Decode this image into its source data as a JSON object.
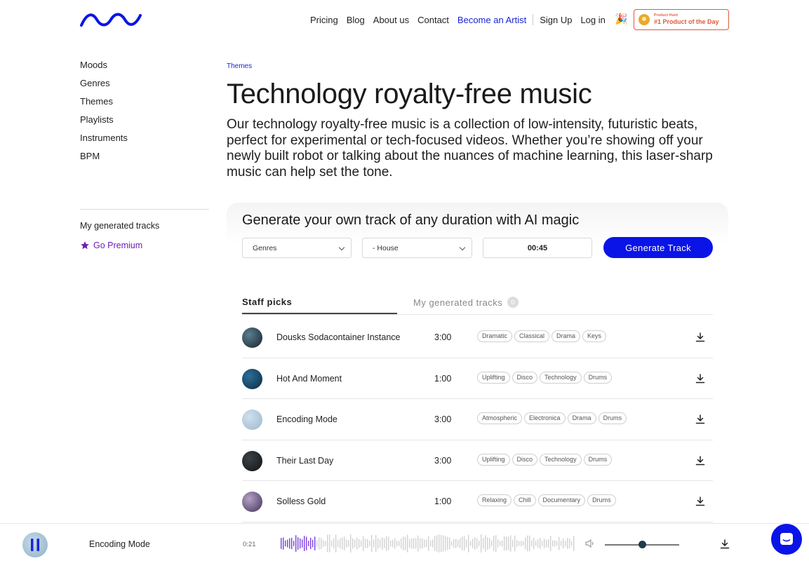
{
  "header": {
    "nav": [
      {
        "label": "Pricing"
      },
      {
        "label": "Blog"
      },
      {
        "label": "About us"
      },
      {
        "label": "Contact"
      },
      {
        "label": "Become an Artist"
      }
    ],
    "signup": "Sign Up",
    "login": "Log in",
    "badge_small": "Product Hunt",
    "badge_big": "#1 Product of the Day",
    "party_icon": "party-popper-icon"
  },
  "sidebar": {
    "items": [
      {
        "label": "Moods"
      },
      {
        "label": "Genres"
      },
      {
        "label": "Themes"
      },
      {
        "label": "Playlists"
      },
      {
        "label": "Instruments"
      },
      {
        "label": "BPM"
      }
    ],
    "generated": "My generated tracks",
    "premium": "Go Premium"
  },
  "main": {
    "breadcrumb": "Themes",
    "title": "Technology royalty-free music",
    "description": "Our technology royalty-free music is a collection of low-intensity, futuristic beats, perfect for experimental or tech-focused videos. Whether you’re showing off your newly built robot or talking about the nuances of machine learning, this laser-sharp music can help set the tone."
  },
  "generator": {
    "title": "Generate your own track of any duration with AI magic",
    "genre_select": "Genres",
    "subgenre_select": "- House",
    "duration": "00:45",
    "button": "Generate Track"
  },
  "tabs": {
    "staff": "Staff picks",
    "mine": "My generated tracks",
    "mine_count": "0"
  },
  "tracks": [
    {
      "name": "Dousks Sodacontainer Instance",
      "duration": "3:00",
      "tags": [
        "Dramatic",
        "Classical",
        "Drama",
        "Keys"
      ],
      "color_a": "#5a7f8f",
      "color_b": "#16222a"
    },
    {
      "name": "Hot And Moment",
      "duration": "1:00",
      "tags": [
        "Uplifting",
        "Disco",
        "Technology",
        "Drums"
      ],
      "color_a": "#2d6f9a",
      "color_b": "#0c2a3e"
    },
    {
      "name": "Encoding Mode",
      "duration": "3:00",
      "tags": [
        "Atmospheric",
        "Electronica",
        "Drama",
        "Drums"
      ],
      "color_a": "#cfe0ec",
      "color_b": "#9bb8cf"
    },
    {
      "name": "Their Last Day",
      "duration": "3:00",
      "tags": [
        "Uplifting",
        "Disco",
        "Technology",
        "Drums"
      ],
      "color_a": "#3b4247",
      "color_b": "#101315"
    },
    {
      "name": "Solless Gold",
      "duration": "1:00",
      "tags": [
        "Relaxing",
        "Chill",
        "Documentary",
        "Drums"
      ],
      "color_a": "#b7a0c8",
      "color_b": "#3d3555"
    }
  ],
  "player": {
    "track_name": "Encoding Mode",
    "elapsed": "0:21",
    "progress": 0.12,
    "volume": 0.5
  },
  "colors": {
    "accent": "#0a14e6",
    "premium": "#6b1fb3",
    "wave_played": "#7a3fe0",
    "wave_unplayed": "#d2d2d2"
  }
}
